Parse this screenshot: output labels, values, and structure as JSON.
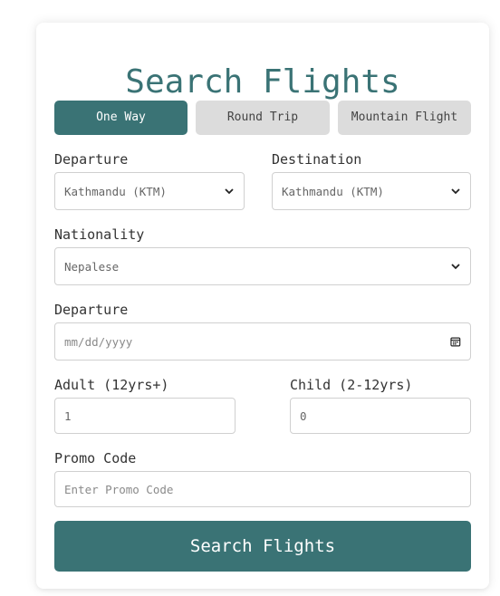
{
  "form": {
    "title": "Search Flights",
    "tabs": [
      {
        "label": "One Way",
        "active": true
      },
      {
        "label": "Round Trip",
        "active": false
      },
      {
        "label": "Mountain Flight",
        "active": false
      }
    ],
    "departure_city": {
      "label": "Departure",
      "selected": "Kathmandu (KTM)"
    },
    "destination_city": {
      "label": "Destination",
      "selected": "Kathmandu (KTM)"
    },
    "nationality": {
      "label": "Nationality",
      "selected": "Nepalese"
    },
    "departure_date": {
      "label": "Departure",
      "placeholder": "mm/dd/yyyy"
    },
    "adult": {
      "label": "Adult (12yrs+)",
      "value": "1"
    },
    "child": {
      "label": "Child (2-12yrs)",
      "value": "0"
    },
    "promo": {
      "label": "Promo Code",
      "placeholder": "Enter Promo Code"
    },
    "submit_label": "Search Flights"
  },
  "colors": {
    "accent": "#3a7375",
    "tab_inactive": "#dcdcdc",
    "border": "#d0d0d0"
  },
  "icons": {
    "select_arrow": "chevron-down-icon",
    "date_picker": "calendar-icon"
  }
}
